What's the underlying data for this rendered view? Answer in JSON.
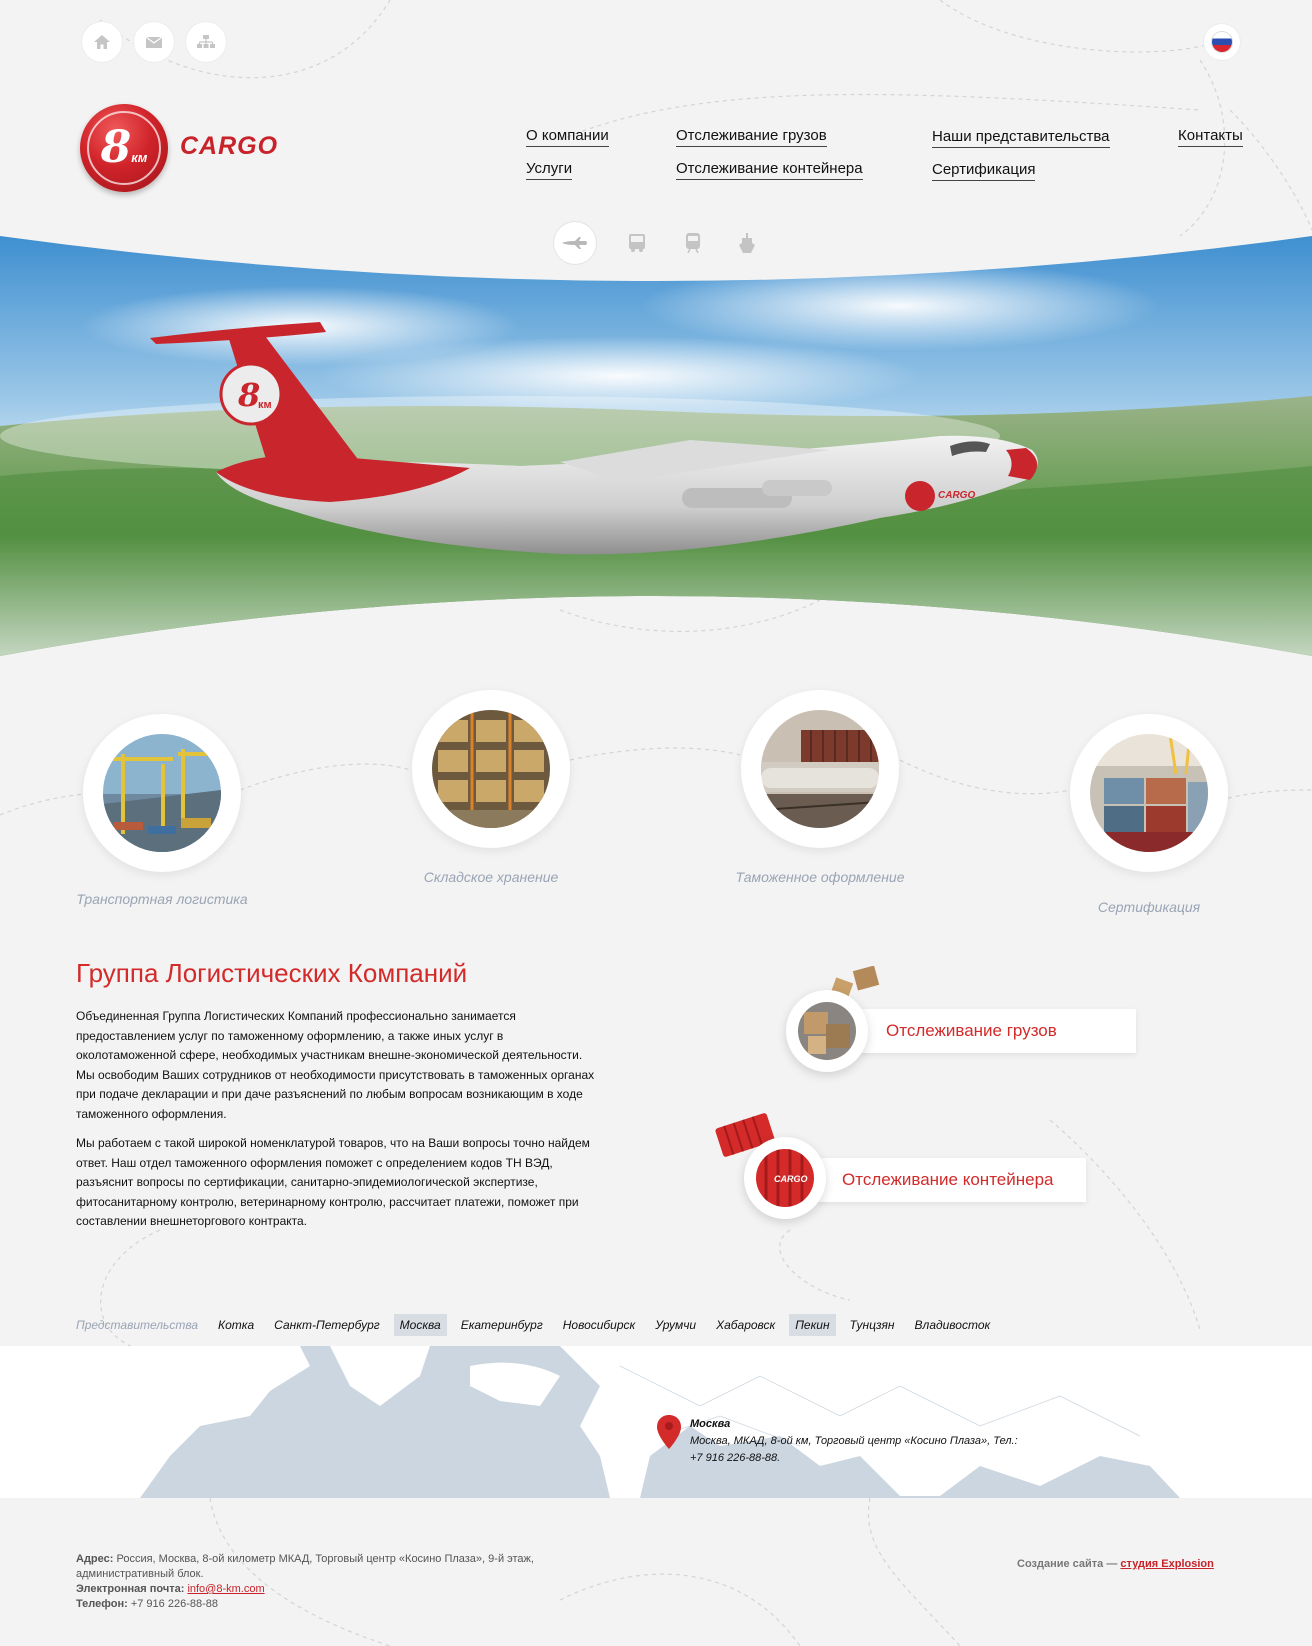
{
  "header": {
    "top_icons": [
      "home-icon",
      "mail-icon",
      "sitemap-icon"
    ],
    "language_flag": "russia-flag",
    "logo": {
      "number": "8",
      "unit": "км",
      "word": "CARGO"
    },
    "nav": [
      {
        "label": "О компании"
      },
      {
        "label": "Услуги"
      },
      {
        "label": "Отслеживание грузов"
      },
      {
        "label": "Отслеживание контейнера"
      },
      {
        "label": "Наши представительства"
      },
      {
        "label": "Сертификация"
      },
      {
        "label": "Контакты"
      }
    ],
    "transport_icons": [
      "airplane-icon",
      "truck-icon",
      "train-icon",
      "ship-icon"
    ]
  },
  "hero": {
    "plane_logo_number": "8",
    "plane_logo_unit": "км",
    "plane_word": "CARGO"
  },
  "services": [
    {
      "label": "Транспортная логистика"
    },
    {
      "label": "Складское хранение"
    },
    {
      "label": "Таможенное оформление"
    },
    {
      "label": "Сертификация"
    }
  ],
  "main": {
    "title": "Группа Логистических Компаний",
    "paragraphs": [
      "Объединенная Группа Логистических Компаний профессионально занимается предоставлением услуг по таможенному оформлению, а также иных услуг в околотаможенной сфере, необходимых участникам внешне-экономической деятельности. Мы освободим Ваших сотрудников от необходимости присутствовать в таможенных органах при подаче декларации и при даче разъяснений по любым вопросам возникающим в ходе таможенного оформления.",
      "Мы работаем с такой широкой номенклатурой товаров, что на Ваши вопросы точно найдем ответ. Наш отдел таможенного оформления поможет с определением кодов ТН ВЭД, разъяснит вопросы по сертификации, санитарно-эпидемиологической экспертизе, фитосанитарному контролю, ветеринарному контролю, рассчитает платежи, поможет при составлении внешнеторгового контракта."
    ]
  },
  "tracking": {
    "cargo": "Отслеживание грузов",
    "container": "Отслеживание контейнера",
    "container_word": "CARGO"
  },
  "offices": {
    "label": "Представительства",
    "cities": [
      "Котка",
      "Санкт-Петербург",
      "Москва",
      "Екатеринбург",
      "Новосибирск",
      "Урумчи",
      "Хабаровск",
      "Пекин",
      "Тунцзян",
      "Владивосток"
    ],
    "selected": [
      "Москва",
      "Пекин"
    ]
  },
  "map": {
    "city": "Москва",
    "address": "Москва, МКАД, 8-ой км, Торговый центр «Косино Плаза», Тел.:",
    "phone": "+7 916 226-88-88."
  },
  "footer": {
    "address_label": "Адрес:",
    "address": "Россия, Москва, 8-ой километр МКАД, Торговый центр «Косино Плаза», 9-й этаж, административный блок.",
    "email_label": "Электронная почта:",
    "email": "info@8-km.com",
    "phone_label": "Телефон:",
    "phone": "+7 916 226-88-88",
    "credit_prefix": "Создание сайта —",
    "credit_link": "студия Explosion"
  },
  "colors": {
    "accent": "#d32a2a",
    "muted_label": "#9aa4b4",
    "map": "#ccd6e0",
    "background": "#f3f3f3"
  }
}
